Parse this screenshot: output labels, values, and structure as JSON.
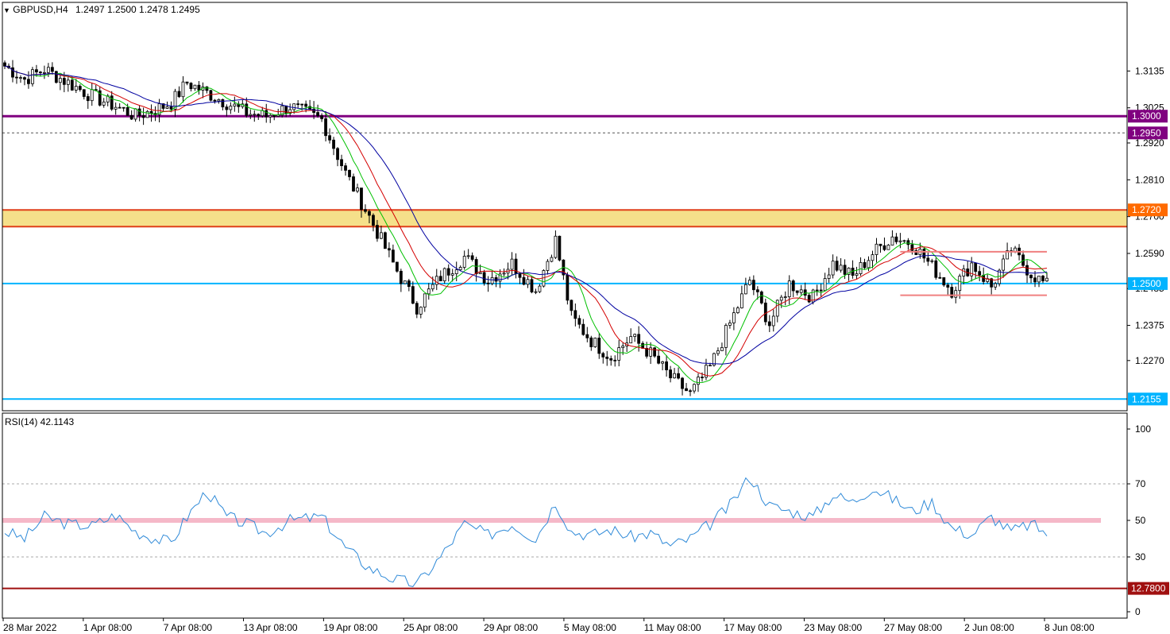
{
  "header": {
    "symbol": "GBPUSD,H4",
    "quote": "1.2497 1.2500 1.2478 1.2495",
    "menu_arrow": "triangle-down-icon"
  },
  "rsi_header": "RSI(14) 42.1143",
  "colors": {
    "bull_bear_candles": "#000000",
    "ma_fast": "#00c000",
    "ma_mid": "#d40000",
    "ma_slow": "#0000a0",
    "rsi_line": "#2f8ad8",
    "level_purple": "#800080",
    "level_cyan": "#00b4ff",
    "zone_fill": "#f5e08a",
    "zone_border": "#e0401a",
    "range_box": "#f08080",
    "rsi_band": "#f5b8c8",
    "rsi_floor": "#a01010"
  },
  "chart_data": {
    "type": "candlestick",
    "symbol": "GBPUSD",
    "timeframe": "H4",
    "y_ticks": [
      "1.3135",
      "1.3025",
      "1.2920",
      "1.2810",
      "1.2700",
      "1.2590",
      "1.2485",
      "1.2375",
      "1.2270"
    ],
    "ylim": [
      1.212,
      1.334
    ],
    "x_ticks": [
      "28 Mar 2022",
      "1 Apr 08:00",
      "7 Apr 08:00",
      "13 Apr 08:00",
      "19 Apr 08:00",
      "25 Apr 08:00",
      "29 Apr 08:00",
      "5 May 08:00",
      "11 May 08:00",
      "17 May 08:00",
      "23 May 08:00",
      "27 May 08:00",
      "2 Jun 08:00",
      "8 Jun 08:00"
    ],
    "levels": [
      {
        "value": 1.3,
        "label": "1.3000",
        "color": "#800080",
        "style": "solid"
      },
      {
        "value": 1.295,
        "label": "1.2950",
        "color": "#800080",
        "style": "dashed"
      },
      {
        "value": 1.272,
        "label": "1.2720",
        "color": "#ff6a00",
        "style": "solid"
      },
      {
        "value": 1.25,
        "label": "1.2500",
        "color": "#00b4ff",
        "style": "solid"
      },
      {
        "value": 1.2155,
        "label": "1.2155",
        "color": "#00b4ff",
        "style": "solid"
      }
    ],
    "zone": [
      1.267,
      1.272
    ],
    "range_box": [
      1.2465,
      1.2595
    ],
    "price_path": [
      [
        0,
        1.315
      ],
      [
        5,
        1.311
      ],
      [
        10,
        1.314
      ],
      [
        16,
        1.31
      ],
      [
        22,
        1.306
      ],
      [
        28,
        1.303
      ],
      [
        33,
        1.3
      ],
      [
        38,
        1.302
      ],
      [
        42,
        1.304
      ],
      [
        46,
        1.31
      ],
      [
        51,
        1.307
      ],
      [
        56,
        1.304
      ],
      [
        61,
        1.301
      ],
      [
        66,
        1.3
      ],
      [
        72,
        1.303
      ],
      [
        80,
        1.299
      ],
      [
        86,
        1.283
      ],
      [
        92,
        1.27
      ],
      [
        98,
        1.256
      ],
      [
        104,
        1.243
      ],
      [
        110,
        1.252
      ],
      [
        116,
        1.258
      ],
      [
        122,
        1.251
      ],
      [
        128,
        1.256
      ],
      [
        134,
        1.248
      ],
      [
        139,
        1.263
      ],
      [
        143,
        1.24
      ],
      [
        148,
        1.233
      ],
      [
        153,
        1.228
      ],
      [
        158,
        1.234
      ],
      [
        163,
        1.229
      ],
      [
        168,
        1.222
      ],
      [
        173,
        1.217
      ],
      [
        178,
        1.225
      ],
      [
        183,
        1.238
      ],
      [
        188,
        1.251
      ],
      [
        193,
        1.238
      ],
      [
        198,
        1.25
      ],
      [
        204,
        1.246
      ],
      [
        209,
        1.256
      ],
      [
        214,
        1.252
      ],
      [
        219,
        1.259
      ],
      [
        224,
        1.264
      ],
      [
        229,
        1.262
      ],
      [
        234,
        1.255
      ],
      [
        239,
        1.248
      ],
      [
        244,
        1.256
      ],
      [
        249,
        1.249
      ],
      [
        254,
        1.26
      ],
      [
        259,
        1.253
      ],
      [
        263,
        1.2495
      ]
    ],
    "bar_count": 264,
    "rsi": {
      "period": 14,
      "value": 42.1143,
      "ylim": [
        0,
        100
      ],
      "ticks": [
        "100",
        "70",
        "50",
        "30",
        "0"
      ],
      "levels": [
        70,
        50,
        30
      ],
      "floor_label": "12.7800",
      "floor_value": 12.78,
      "path": [
        [
          0,
          44
        ],
        [
          5,
          40
        ],
        [
          10,
          52
        ],
        [
          16,
          48
        ],
        [
          22,
          47
        ],
        [
          28,
          53
        ],
        [
          33,
          44
        ],
        [
          38,
          40
        ],
        [
          42,
          38
        ],
        [
          46,
          52
        ],
        [
          51,
          66
        ],
        [
          56,
          52
        ],
        [
          61,
          48
        ],
        [
          66,
          43
        ],
        [
          72,
          50
        ],
        [
          80,
          52
        ],
        [
          86,
          35
        ],
        [
          92,
          24
        ],
        [
          98,
          18
        ],
        [
          104,
          15
        ],
        [
          110,
          30
        ],
        [
          116,
          48
        ],
        [
          122,
          42
        ],
        [
          128,
          48
        ],
        [
          134,
          40
        ],
        [
          139,
          60
        ],
        [
          143,
          44
        ],
        [
          148,
          42
        ],
        [
          153,
          45
        ],
        [
          158,
          41
        ],
        [
          163,
          43
        ],
        [
          168,
          36
        ],
        [
          173,
          40
        ],
        [
          178,
          48
        ],
        [
          183,
          58
        ],
        [
          188,
          74
        ],
        [
          193,
          58
        ],
        [
          198,
          55
        ],
        [
          204,
          52
        ],
        [
          209,
          64
        ],
        [
          214,
          60
        ],
        [
          219,
          68
        ],
        [
          224,
          62
        ],
        [
          229,
          55
        ],
        [
          234,
          60
        ],
        [
          239,
          46
        ],
        [
          244,
          42
        ],
        [
          249,
          52
        ],
        [
          254,
          44
        ],
        [
          259,
          48
        ],
        [
          263,
          43
        ]
      ]
    }
  }
}
